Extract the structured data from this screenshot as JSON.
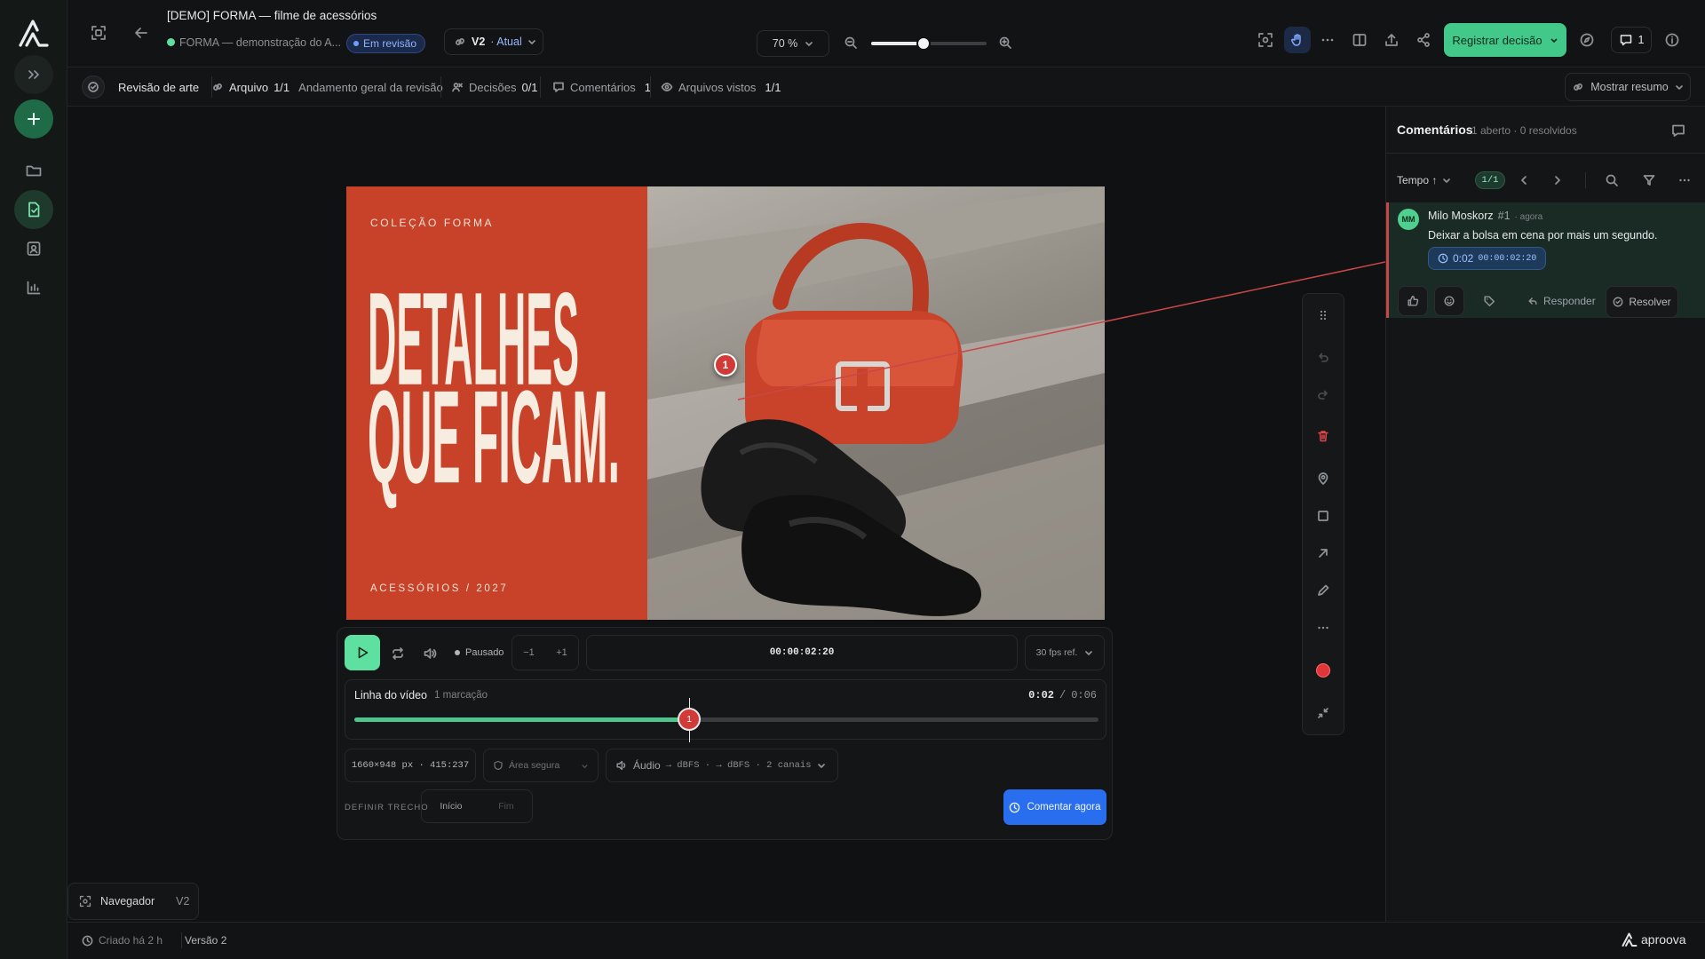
{
  "app": {
    "name": "aproova"
  },
  "header": {
    "title": "[DEMO] FORMA — filme de acessórios",
    "project": "FORMA — demonstração do A...",
    "status": "Em revisão",
    "version": "V2",
    "version_label": "· Atual",
    "zoom": "70 %",
    "zoom_level": 0.45,
    "primary_action": "Registrar decisão",
    "comments_count": "1"
  },
  "subbar": {
    "review": "Revisão de arte",
    "file_label": "Arquivo",
    "file_value": "1/1",
    "progress_label": "Andamento geral da revisão",
    "decisions_label": "Decisões",
    "decisions_value": "0/1",
    "comments_label": "Comentários",
    "comments_value": "1",
    "viewed_label": "Arquivos vistos",
    "viewed_value": "1/1",
    "summary": "Mostrar resumo"
  },
  "artwork": {
    "collection": "COLEÇÃO FORMA",
    "headline_1": "DETALHES",
    "headline_2": "QUE FICAM.",
    "footer": "ACESSÓRIOS / 2027",
    "pin": "1",
    "accent": "#c8422a"
  },
  "player": {
    "state": "Pausado",
    "step_back": "−1",
    "step_fwd": "+1",
    "timecode": "00:00:02:20",
    "fps": "30 fps ref.",
    "timeline_title": "Linha do vídeo",
    "timeline_marks": "1 marcação",
    "current": "0:02",
    "divider": "/",
    "duration": "0:06",
    "progress": 0.45,
    "marker": "1",
    "dimensions": "1660×948 px · 415:237",
    "safe_area": "Área segura",
    "audio_label": "Áudio",
    "audio_meta": "→ dBFS · → dBFS · 2 canais",
    "range_label": "DEFINIR TRECHO",
    "range_start": "Início",
    "range_end": "Fim",
    "comment_now": "Comentar agora"
  },
  "comments": {
    "title": "Comentários",
    "summary": "1 aberto · 0 resolvidos",
    "sort": "Tempo ↑",
    "page": "1/1",
    "items": [
      {
        "initials": "MM",
        "author": "Milo Moskorz",
        "number": "#1",
        "time": "· agora",
        "text": "Deixar a bolsa em cena por mais um segundo.",
        "ts_short": "0:02",
        "ts_full": "00:00:02:20",
        "reply": "Responder",
        "resolve": "Resolver"
      }
    ]
  },
  "navigator": {
    "label": "Navegador",
    "version": "V2"
  },
  "footer": {
    "created": "Criado há 2 h",
    "version": "Versão 2"
  },
  "colors": {
    "accent_green": "#5ee0a0",
    "accent_blue": "#2a6ef0",
    "comment_red": "#c24a4a"
  }
}
